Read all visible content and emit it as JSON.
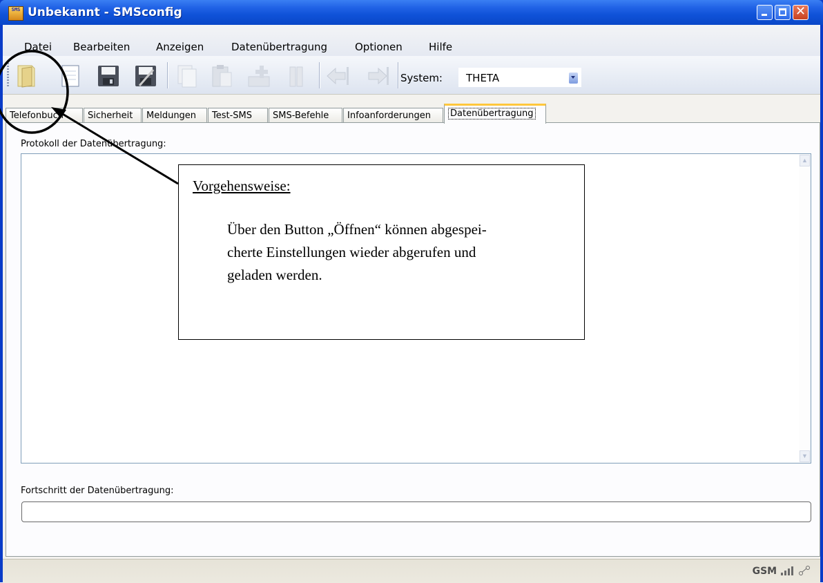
{
  "window": {
    "title": "Unbekannt - SMSconfig",
    "app_icon_text": "SMS",
    "close_glyph": "✕"
  },
  "menu": {
    "items": [
      "Datei",
      "Bearbeiten",
      "Anzeigen",
      "Datenübertragung",
      "Optionen",
      "Hilfe"
    ]
  },
  "toolbar": {
    "buttons": [
      "open-icon",
      "new-icon",
      "save-icon",
      "save-as-icon",
      "copy-icon",
      "paste-icon",
      "add-icon",
      "delete-icon",
      "back-icon",
      "forward-icon"
    ],
    "system_label": "System:",
    "system_value": "THETA"
  },
  "tabs": {
    "items": [
      "Telefonbuch",
      "Sicherheit",
      "Meldungen",
      "Test-SMS",
      "SMS-Befehle",
      "Infoanforderungen",
      "Datenübertragung"
    ],
    "active": "Datenübertragung"
  },
  "panel": {
    "log_label": "Protokoll der Datenübertragung:",
    "progress_label": "Fortschritt der Datenübertragung:",
    "progress_value": 0
  },
  "status": {
    "gsm": "GSM"
  },
  "callout": {
    "heading": "Vorgehensweise:",
    "lines": [
      "Über den Button „Öffnen“ können abgespei-",
      "cherte Einstellungen wieder abgerufen und",
      "geladen werden."
    ]
  },
  "colors": {
    "titlebar": "#0f52d8",
    "tab_highlight": "#ffc73c",
    "annotation": "#000000"
  }
}
